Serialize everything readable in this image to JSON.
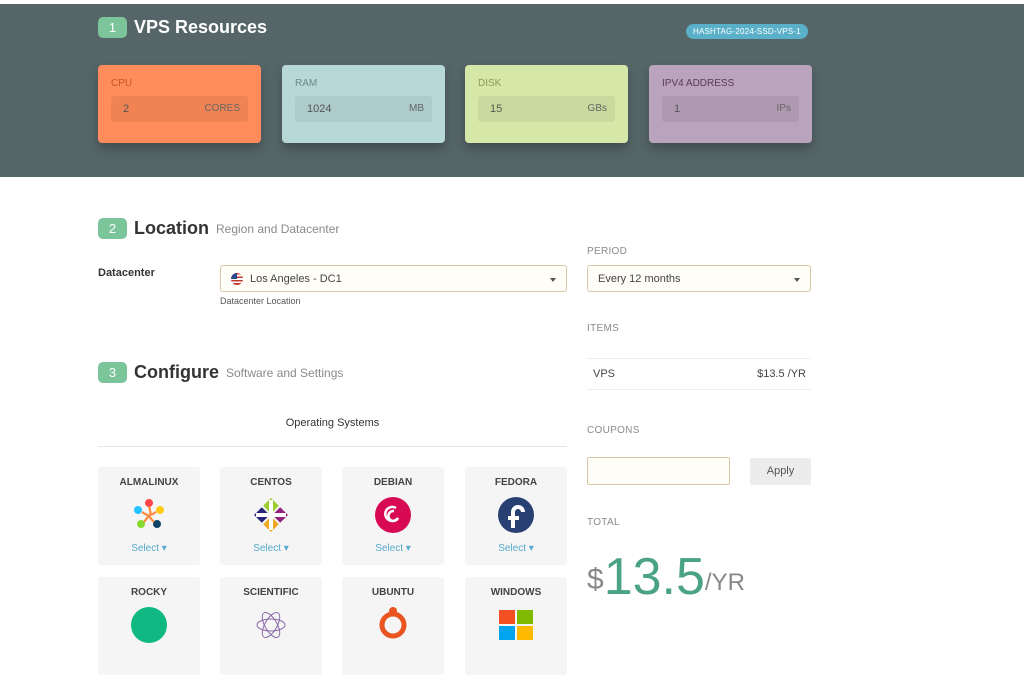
{
  "header": {
    "step": "1",
    "title": "VPS Resources",
    "plan_tag": "HASHTAG-2024-SSD-VPS-1"
  },
  "resources": [
    {
      "label": "CPU",
      "value": "2",
      "unit": "CORES",
      "bg": "#ff8c5a"
    },
    {
      "label": "RAM",
      "value": "1024",
      "unit": "MB",
      "bg": "#b8d8d8"
    },
    {
      "label": "DISK",
      "value": "15",
      "unit": "GBs",
      "bg": "#d6e8a8"
    },
    {
      "label": "IPV4 ADDRESS",
      "value": "1",
      "unit": "IPs",
      "bg": "#b9a3bd"
    }
  ],
  "location": {
    "step": "2",
    "title": "Location",
    "subtitle": "Region and Datacenter",
    "datacenter_label": "Datacenter",
    "datacenter_value": "Los Angeles - DC1",
    "datacenter_flag": "us-flag-icon",
    "datacenter_hint": "Datacenter Location"
  },
  "configure": {
    "step": "3",
    "title": "Configure",
    "subtitle": "Software and Settings",
    "os_tab": "Operating Systems",
    "os": [
      {
        "name": "ALMALINUX",
        "select": "Select",
        "icon": "almalinux-logo-icon"
      },
      {
        "name": "CENTOS",
        "select": "Select",
        "icon": "centos-logo-icon"
      },
      {
        "name": "DEBIAN",
        "select": "Select",
        "icon": "debian-logo-icon"
      },
      {
        "name": "FEDORA",
        "select": "Select",
        "icon": "fedora-logo-icon"
      },
      {
        "name": "ROCKY",
        "icon": "rocky-logo-icon"
      },
      {
        "name": "SCIENTIFIC",
        "icon": "scientific-logo-icon"
      },
      {
        "name": "UBUNTU",
        "icon": "ubuntu-logo-icon"
      },
      {
        "name": "WINDOWS",
        "icon": "windows-logo-icon"
      }
    ]
  },
  "summary": {
    "period_label": "PERIOD",
    "period_value": "Every 12 months",
    "items_label": "ITEMS",
    "item_name": "VPS",
    "item_price": "$13.5 /YR",
    "coupons_label": "COUPONS",
    "coupon_value": "",
    "apply_label": "Apply",
    "total_label": "TOTAL",
    "total_currency": "$",
    "total_amount": "13.5",
    "total_period": "/YR"
  },
  "colors": {
    "accent_green": "#4aa383",
    "header_bg": "#566668"
  }
}
